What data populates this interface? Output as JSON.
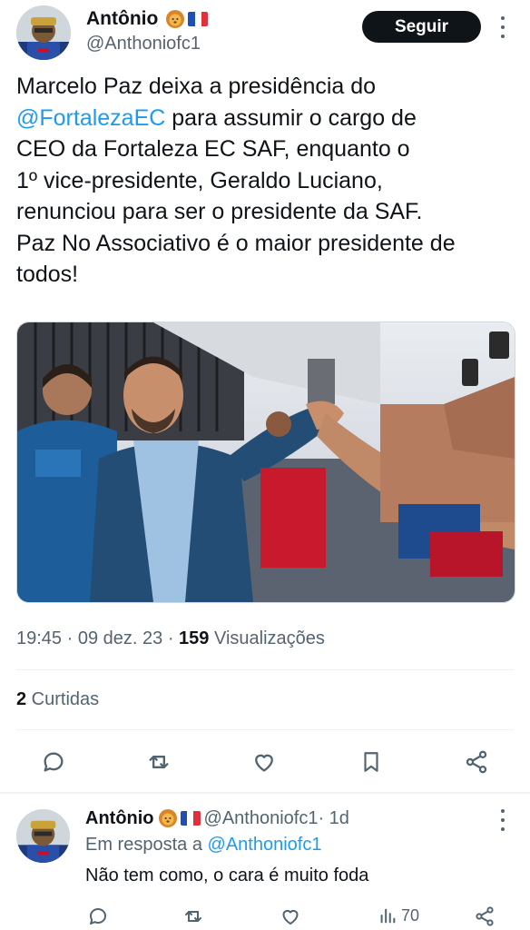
{
  "tweet": {
    "author": {
      "display_name": "Antônio",
      "handle": "@Anthoniofc1",
      "badges": [
        "lion-emoji",
        "france-flag-emoji"
      ]
    },
    "follow_label": "Seguir",
    "text_parts": {
      "line1": "Marcelo Paz deixa a presidência do\n",
      "mention": "@FortalezaEC",
      "rest": " para assumir o cargo de\nCEO da Fortaleza EC SAF, enquanto o\n1º vice-presidente, Geraldo Luciano,\nrenunciou para ser o presidente da SAF.\nPaz No Associativo é o maior presidente de\ntodos!"
    },
    "meta": {
      "time": "19:45",
      "sep1": " · ",
      "date": "09 dez. 23",
      "sep2": " · ",
      "views_count": "159",
      "views_label": " Visualizações"
    },
    "retweets": {
      "count": "2",
      "label": " Curtidas"
    },
    "actions": [
      "reply-icon",
      "retweet-icon",
      "like-icon",
      "bookmark-icon",
      "share-icon"
    ]
  },
  "reply": {
    "display_name": "Antônio",
    "handle": "@Anthoniofc1",
    "time": " · 1d",
    "reply_prefix": "Em resposta a ",
    "reply_to": "@Anthoniofc1",
    "text": "Não tem como, o cara é muito foda",
    "views": "70",
    "actions": [
      "reply-icon",
      "retweet-icon",
      "like-icon",
      "views-icon",
      "share-icon"
    ]
  },
  "colors": {
    "accent": "#1d9bf0",
    "text": "#0f1419",
    "muted": "#536471",
    "follow_button": "#0f1419"
  }
}
